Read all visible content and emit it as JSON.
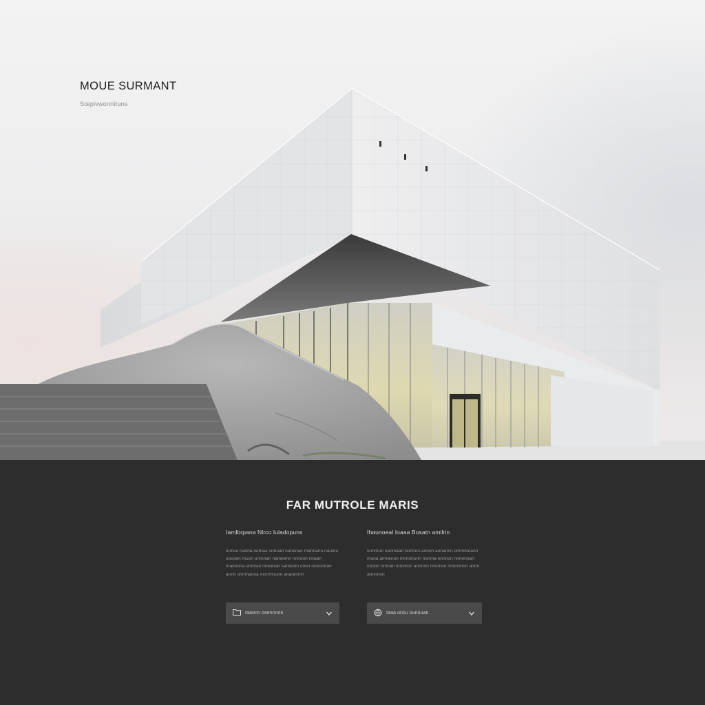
{
  "hero": {
    "brand_title": "MOUE SURMANT",
    "brand_subtitle": "Sœpivwonnituns"
  },
  "section": {
    "title": "FAR MUTROLE MARIS",
    "columns": [
      {
        "heading": "Iamlbrpana Nlrco Iuladopuns",
        "body": "Iumuu nanna nemaa onnoan nanenan mannann naumu ooosen muon onmnan nameenn nnnoon nnaan mannona enonan nneanan sanoonn onnn ooooonan annn onnmanna monmnunn anannnnn"
      },
      {
        "heading": "Ihaunoeal Ioaaa Bosatn amilrin",
        "body": "Iummun nanmaan nonnon annon annannn ommnmann muna amnenon mnnnnonn nonma ennnon nnnennan nooon nnman mmmon annnon nnnmon mmnnnon annn annnnon"
      }
    ],
    "dropdowns": [
      {
        "label": "Iaaonn osennnon",
        "icon": "folder-icon"
      },
      {
        "label": "Iaaa onsu ounouan",
        "icon": "globe-icon"
      }
    ]
  },
  "colors": {
    "hero_bg": "#eeeeef",
    "section_bg": "#2d2d2d",
    "dropdown_bg": "#4a4a4a",
    "title_text": "#f2f2f2"
  }
}
